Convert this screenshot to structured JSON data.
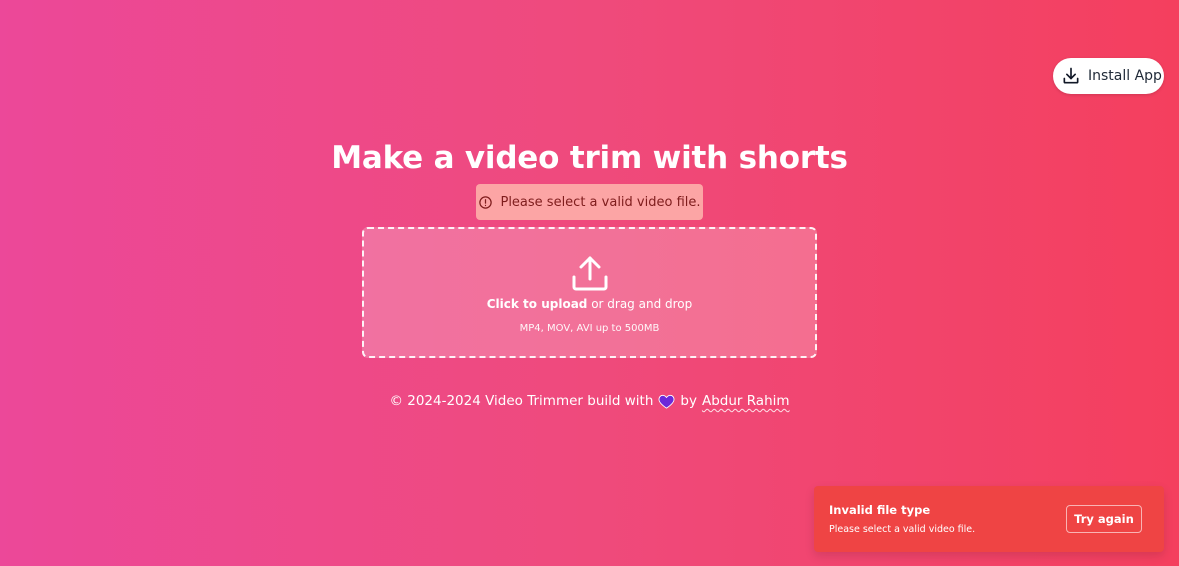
{
  "header": {
    "install_label": "Install App",
    "install_icon": "download-icon"
  },
  "main": {
    "title": "Make a video trim with shorts",
    "error_message": "Please select a valid video file.",
    "error_icon": "alert-circle-icon",
    "dropzone": {
      "click_label": "Click to upload",
      "drag_label": " or drag and drop",
      "formats": "MP4, MOV, AVI up to 500MB",
      "icon": "upload-icon"
    }
  },
  "footer": {
    "prefix": "© 2024-2024 Video Trimmer build with",
    "heart_icon": "heart-icon",
    "by": "by",
    "author": "Abdur Rahim"
  },
  "toast": {
    "title": "Invalid file type",
    "description": "Please select a valid video file.",
    "action_label": "Try again"
  },
  "colors": {
    "gradient_start": "#ec4899",
    "gradient_end": "#f43f5e",
    "toast_bg": "#ef4444",
    "error_pill_bg": "#fca5a5",
    "heart": "#6d28d9"
  }
}
